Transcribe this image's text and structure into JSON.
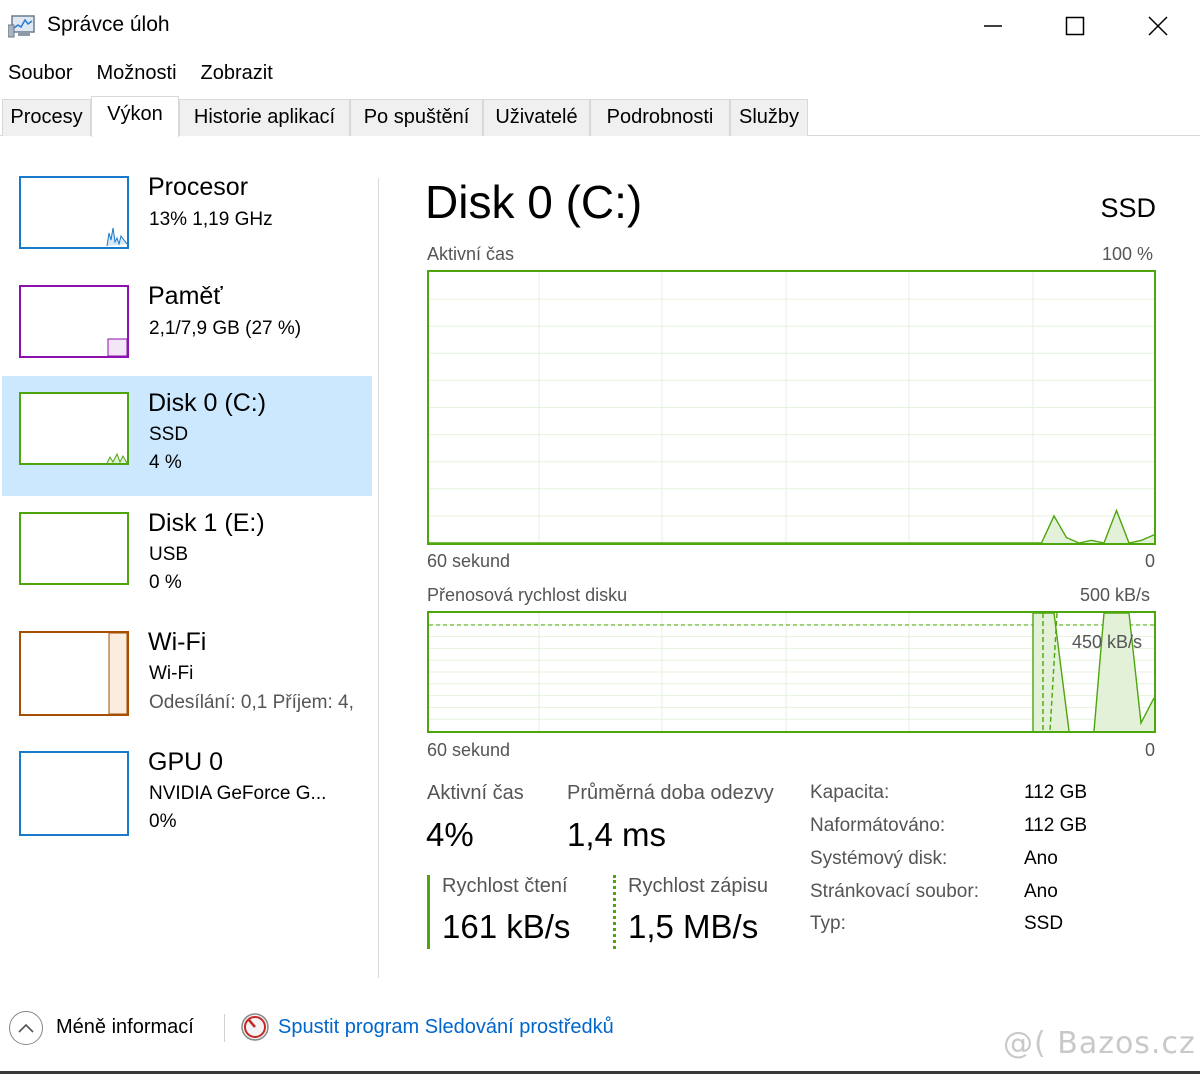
{
  "window": {
    "title": "Správce úloh"
  },
  "menu": [
    "Soubor",
    "Možnosti",
    "Zobrazit"
  ],
  "tabs": [
    "Procesy",
    "Výkon",
    "Historie aplikací",
    "Po spuštění",
    "Uživatelé",
    "Podrobnosti",
    "Služby"
  ],
  "active_tab": "Výkon",
  "resources": [
    {
      "name": "Procesor",
      "line1": "13%  1,19 GHz",
      "line2": "",
      "color": "#1979ca"
    },
    {
      "name": "Paměť",
      "line1": "2,1/7,9 GB (27 %)",
      "line2": "",
      "color": "#8b12ae"
    },
    {
      "name": "Disk 0 (C:)",
      "line1": "SSD",
      "line2": "4 %",
      "color": "#4da60c"
    },
    {
      "name": "Disk 1 (E:)",
      "line1": "USB",
      "line2": "0 %",
      "color": "#4da60c"
    },
    {
      "name": "Wi-Fi",
      "line1": "Wi-Fi",
      "line2": "Odesílání: 0,1  Příjem: 4,",
      "color": "#a74f01"
    },
    {
      "name": "GPU 0",
      "line1": "NVIDIA GeForce G...",
      "line2": "0%",
      "color": "#1979ca"
    }
  ],
  "detail": {
    "title": "Disk 0 (C:)",
    "type": "SSD",
    "active_chart": {
      "label": "Aktivní čas",
      "max": "100 %",
      "time": "60 sekund",
      "min": "0",
      "values": [
        0,
        0,
        0,
        0,
        0,
        0,
        0,
        0,
        0,
        0,
        0,
        0,
        0,
        0,
        0,
        0,
        0,
        0,
        0,
        0,
        0,
        0,
        0,
        0,
        0,
        0,
        0,
        0,
        0,
        0,
        0,
        0,
        0,
        0,
        0,
        0,
        0,
        0,
        0,
        0,
        0,
        0,
        0,
        0,
        0,
        0,
        0,
        0,
        0,
        0,
        10,
        2,
        0,
        1,
        0,
        12,
        0,
        1,
        3
      ]
    },
    "transfer_chart": {
      "label": "Přenosová rychlost disku",
      "max": "500 kB/s",
      "ref": "450 kB/s",
      "time": "60 sekund",
      "min": "0"
    },
    "stats": {
      "active_label": "Aktivní čas",
      "active_value": "4%",
      "response_label": "Průměrná doba odezvy",
      "response_value": "1,4 ms",
      "read_label": "Rychlost čtení",
      "read_value": "161 kB/s",
      "write_label": "Rychlost zápisu",
      "write_value": "1,5 MB/s"
    },
    "properties": [
      {
        "label": "Kapacita:",
        "value": "112 GB"
      },
      {
        "label": "Naformátováno:",
        "value": "112 GB"
      },
      {
        "label": "Systémový disk:",
        "value": "Ano"
      },
      {
        "label": "Stránkovací soubor:",
        "value": "Ano"
      },
      {
        "label": "Typ:",
        "value": "SSD"
      }
    ]
  },
  "footer": {
    "less_info": "Méně informací",
    "open_monitor": "Spustit program Sledování prostředků"
  },
  "watermark": "@( Bazos.cz"
}
